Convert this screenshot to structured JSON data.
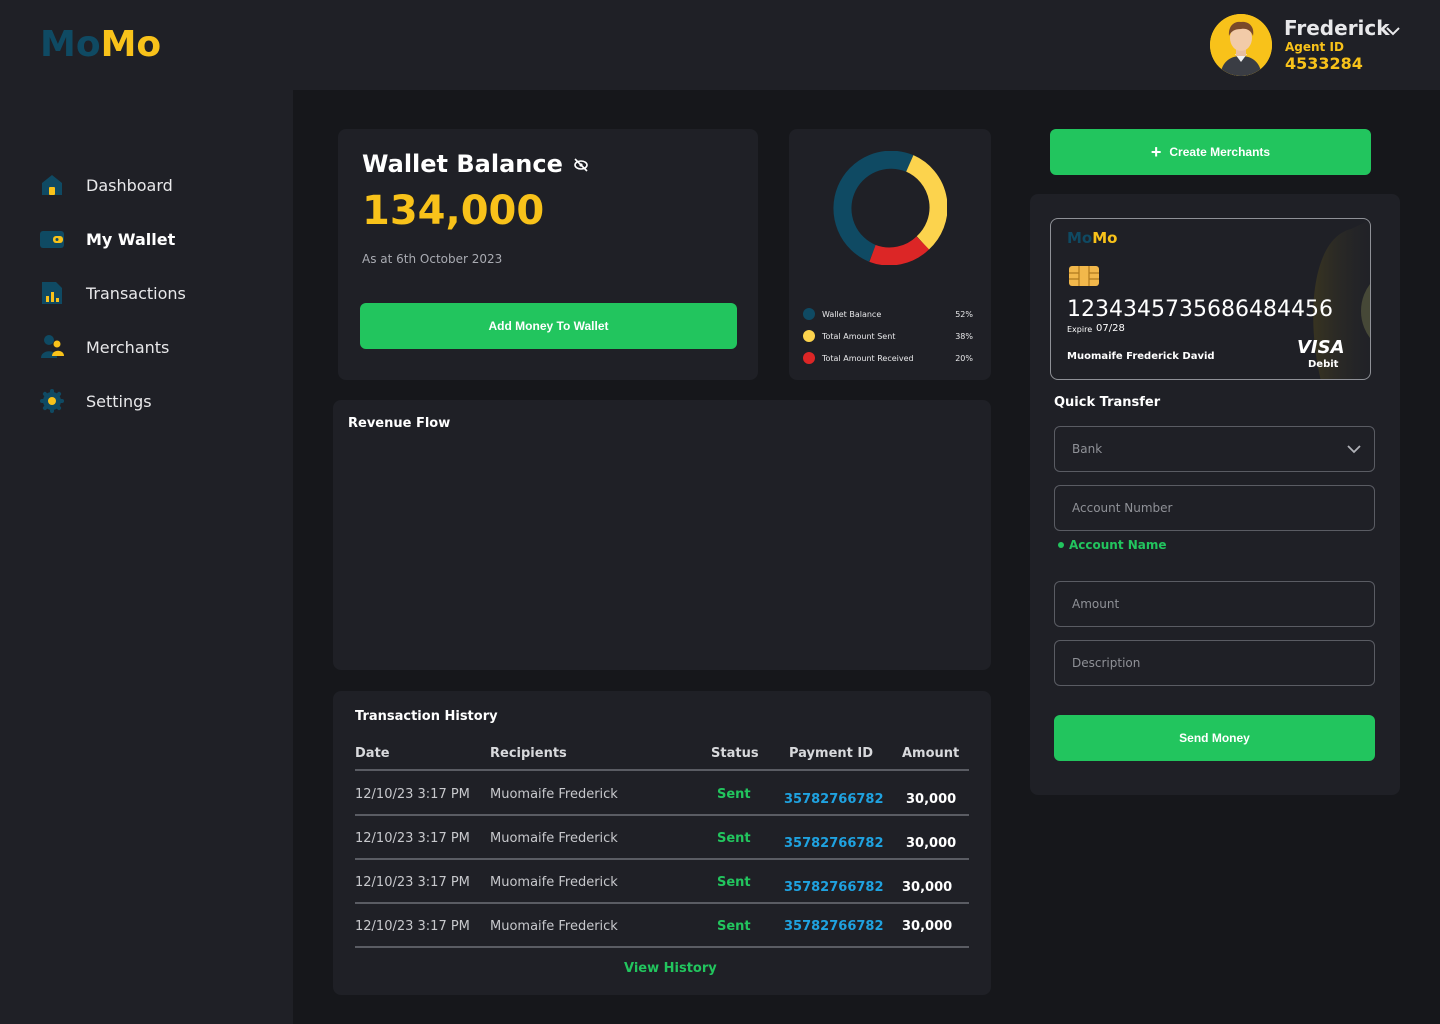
{
  "brand": {
    "part1": "Mo",
    "part2": "Mo"
  },
  "sidebar": {
    "items": [
      {
        "label": "Dashboard",
        "icon": "home-icon"
      },
      {
        "label": "My Wallet",
        "icon": "wallet-icon",
        "active": true
      },
      {
        "label": "Transactions",
        "icon": "transactions-chart-icon"
      },
      {
        "label": "Merchants",
        "icon": "merchants-users-icon"
      },
      {
        "label": "Settings",
        "icon": "gear-icon"
      }
    ]
  },
  "user": {
    "name": "Frederick",
    "agent_label": "Agent ID",
    "agent_id": "4533284"
  },
  "wallet": {
    "title": "Wallet Balance",
    "amount": "134,000",
    "as_at": "As at 6th October 2023",
    "add_button": "Add Money To Wallet"
  },
  "breakdown": {
    "legend": [
      {
        "name": "Wallet Balance",
        "percent": "52%",
        "color": "#0f4a63"
      },
      {
        "name": "Total Amount Sent",
        "percent": "38%",
        "color": "#fcd34d"
      },
      {
        "name": "Total Amount Received",
        "percent": "20%",
        "color": "#dc2626"
      }
    ]
  },
  "revenue": {
    "title": "Revenue Flow"
  },
  "history": {
    "title": "Transaction History",
    "columns": [
      "Date",
      "Recipients",
      "Status",
      "Payment ID",
      "Amount"
    ],
    "rows": [
      {
        "date": "12/10/23  3:17 PM",
        "recipient": "Muomaife Frederick",
        "status": "Sent",
        "payment_id": "35782766782",
        "amount": "30,000"
      },
      {
        "date": "12/10/23  3:17 PM",
        "recipient": "Muomaife Frederick",
        "status": "Sent",
        "payment_id": "35782766782",
        "amount": "30,000"
      },
      {
        "date": "12/10/23  3:17 PM",
        "recipient": "Muomaife Frederick",
        "status": "Sent",
        "payment_id": "35782766782",
        "amount": "30,000"
      },
      {
        "date": "12/10/23  3:17 PM",
        "recipient": "Muomaife Frederick",
        "status": "Sent",
        "payment_id": "35782766782",
        "amount": "30,000"
      }
    ],
    "view_all": "View History"
  },
  "merchants": {
    "create_button": "Create Merchants"
  },
  "card": {
    "brand1": "Mo",
    "brand2": "Mo",
    "number": "1234345735686484456",
    "expire_label": "Expire",
    "expire": "07/28",
    "holder": "Muomaife Frederick David",
    "network": "VISA",
    "type": "Debit"
  },
  "transfer": {
    "title": "Quick Transfer",
    "bank_placeholder": "Bank",
    "account_number_placeholder": "Account Number",
    "account_name": "Account Name",
    "amount_placeholder": "Amount",
    "description_placeholder": "Description",
    "send_button": "Send Money"
  },
  "colors": {
    "accent_green": "#22c55e",
    "brand_yellow": "#f8c21a",
    "brand_teal": "#0f4a63",
    "link_blue": "#1fa2e0"
  }
}
